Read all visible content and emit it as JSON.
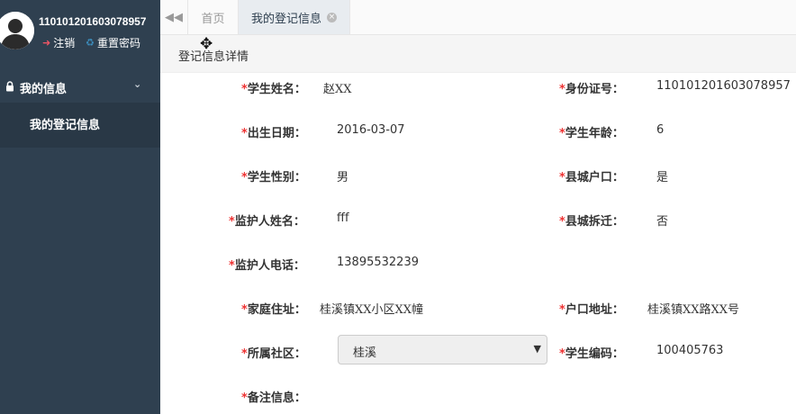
{
  "user": {
    "name": "110101201603078957",
    "logout_label": "注销",
    "reset_password_label": "重置密码"
  },
  "sidebar": {
    "group_label": "我的信息",
    "items": [
      {
        "label": "我的登记信息"
      }
    ]
  },
  "tabs": [
    {
      "label": "首页",
      "active": false
    },
    {
      "label": "我的登记信息",
      "active": true,
      "closable": true
    }
  ],
  "page": {
    "title": "登记信息详情"
  },
  "form": {
    "student_name": {
      "label": "学生姓名：",
      "value": "赵XX",
      "required": true
    },
    "id_number": {
      "label": "身份证号：",
      "value": "110101201603078957",
      "required": true
    },
    "birth_date": {
      "label": "出生日期：",
      "value": "2016-03-07",
      "required": true
    },
    "student_age": {
      "label": "学生年龄：",
      "value": "6",
      "required": true
    },
    "student_gender": {
      "label": "学生性别：",
      "value": "男",
      "required": true
    },
    "county_hukou": {
      "label": "县城户口：",
      "value": "是",
      "required": true
    },
    "guardian_name": {
      "label": "监护人姓名：",
      "value": "fff",
      "required": true
    },
    "county_relocation": {
      "label": "县城拆迁：",
      "value": "否",
      "required": true
    },
    "guardian_phone": {
      "label": "监护人电话：",
      "value": "13895532239",
      "required": true
    },
    "home_address": {
      "label": "家庭住址：",
      "value": "桂溪镇XX小区XX幢",
      "required": true
    },
    "hukou_address": {
      "label": "户口地址：",
      "value": "桂溪镇XX路XX号",
      "required": true
    },
    "community": {
      "label": "所属社区：",
      "value": "桂溪",
      "required": true
    },
    "student_code": {
      "label": "学生编码：",
      "value": "100405763",
      "required": true
    },
    "remarks": {
      "label": "备注信息：",
      "value": "",
      "required": true
    }
  },
  "icons": {
    "avatar": "user-avatar",
    "logout": "sign-out-icon",
    "reset": "recycle-icon",
    "lock": "lock-icon",
    "chevron": "chevron-down-icon",
    "back": "double-left-icon",
    "close": "close-circle-icon",
    "cursor": "move-cursor-icon"
  },
  "colors": {
    "sidebar_bg": "#2f4050",
    "submenu_bg": "#293846",
    "required": "#ee3333",
    "logout_icon": "#ed5565",
    "reset_icon": "#3c8dbc"
  }
}
